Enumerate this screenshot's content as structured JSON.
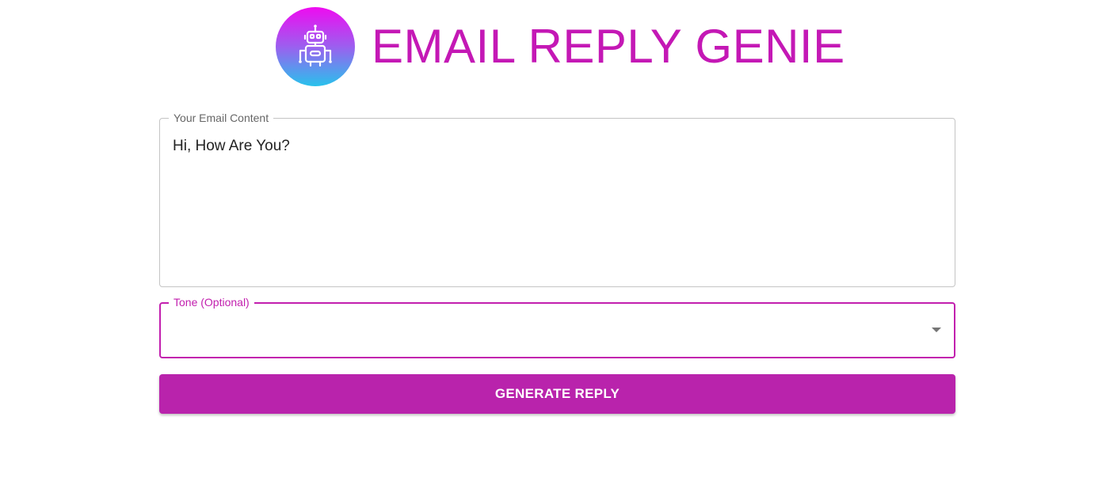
{
  "header": {
    "title": "EMAIL REPLY GENIE",
    "logo_icon": "robot-icon",
    "logo_gradient": [
      "#ef0bf0",
      "#9c5fef",
      "#28c2ec"
    ]
  },
  "email_field": {
    "label": "Your Email Content",
    "value": "Hi, How Are You?"
  },
  "tone_field": {
    "label": "Tone (Optional)",
    "value": "",
    "icon": "dropdown-arrow-icon"
  },
  "actions": {
    "generate_label": "GENERATE REPLY"
  },
  "colors": {
    "accent": "#c21fae",
    "button": "#b923ac",
    "title": "#c418b5"
  }
}
